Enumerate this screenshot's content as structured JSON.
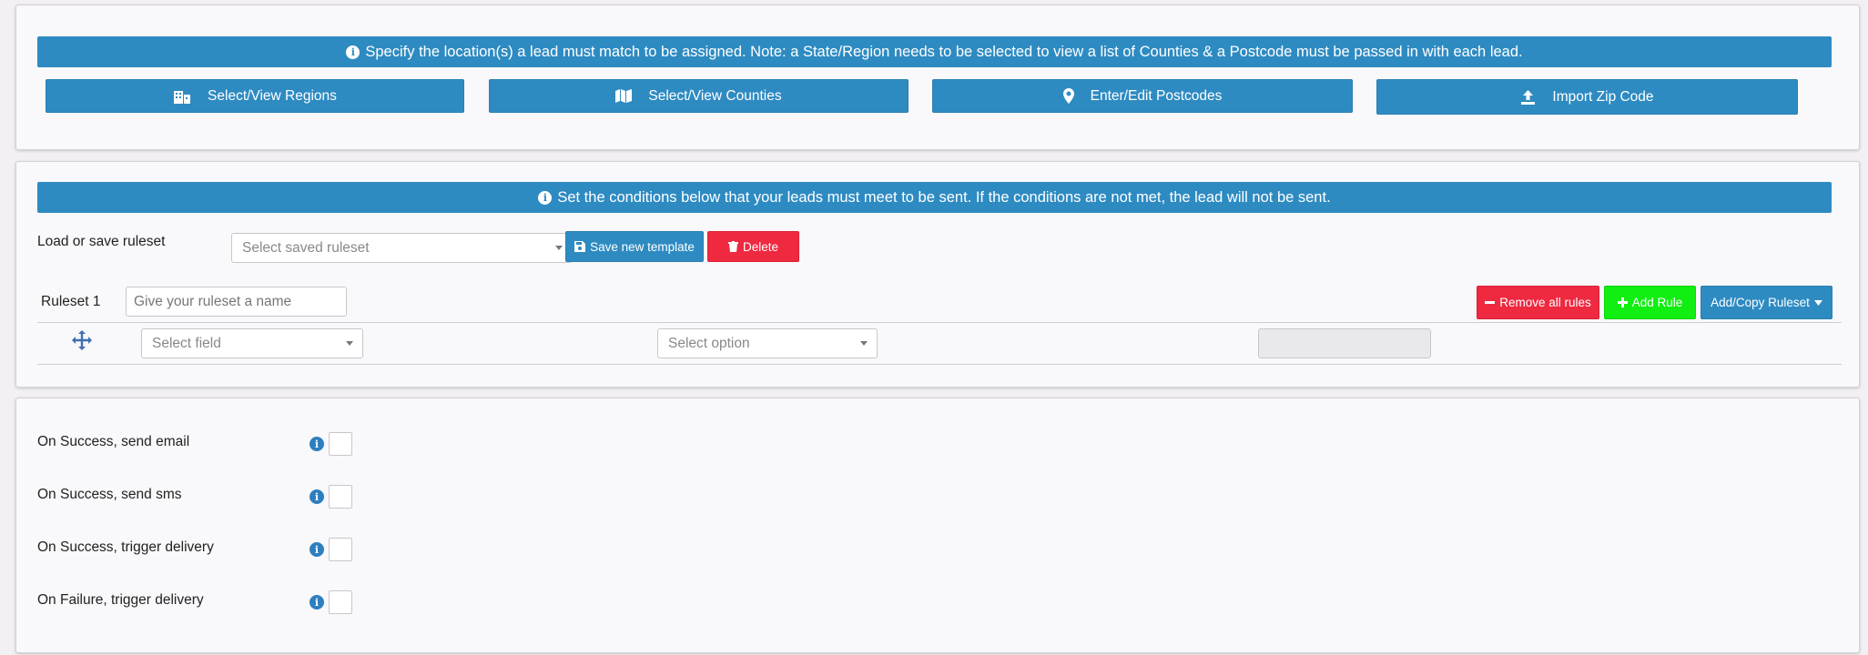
{
  "location": {
    "info_text": "Specify the location(s) a lead must match to be assigned. Note: a State/Region needs to be selected to view a list of Counties & a Postcode must be passed in with each lead.",
    "buttons": {
      "regions": "Select/View Regions",
      "counties": "Select/View Counties",
      "postcodes": "Enter/Edit Postcodes",
      "import": "Import Zip Code"
    }
  },
  "conditions": {
    "info_text": "Set the conditions below that your leads must meet to be sent. If the conditions are not met, the lead will not be sent.",
    "load_save_label": "Load or save ruleset",
    "ruleset_select_placeholder": "Select saved ruleset",
    "save_template_label": "Save new template",
    "delete_label": "Delete",
    "ruleset_label": "Ruleset 1",
    "ruleset_name_placeholder": "Give your ruleset a name",
    "remove_all_label": "Remove all rules",
    "add_rule_label": "Add Rule",
    "add_copy_label": "Add/Copy Ruleset",
    "rule": {
      "field_placeholder": "Select field",
      "option_placeholder": "Select option"
    }
  },
  "actions": {
    "items": [
      {
        "label": "On Success, send email"
      },
      {
        "label": "On Success, send sms"
      },
      {
        "label": "On Success, trigger delivery"
      },
      {
        "label": "On Failure, trigger delivery"
      }
    ]
  },
  "colors": {
    "primary": "#2e8bc2",
    "danger": "#ee2940",
    "success": "#11ee11"
  }
}
